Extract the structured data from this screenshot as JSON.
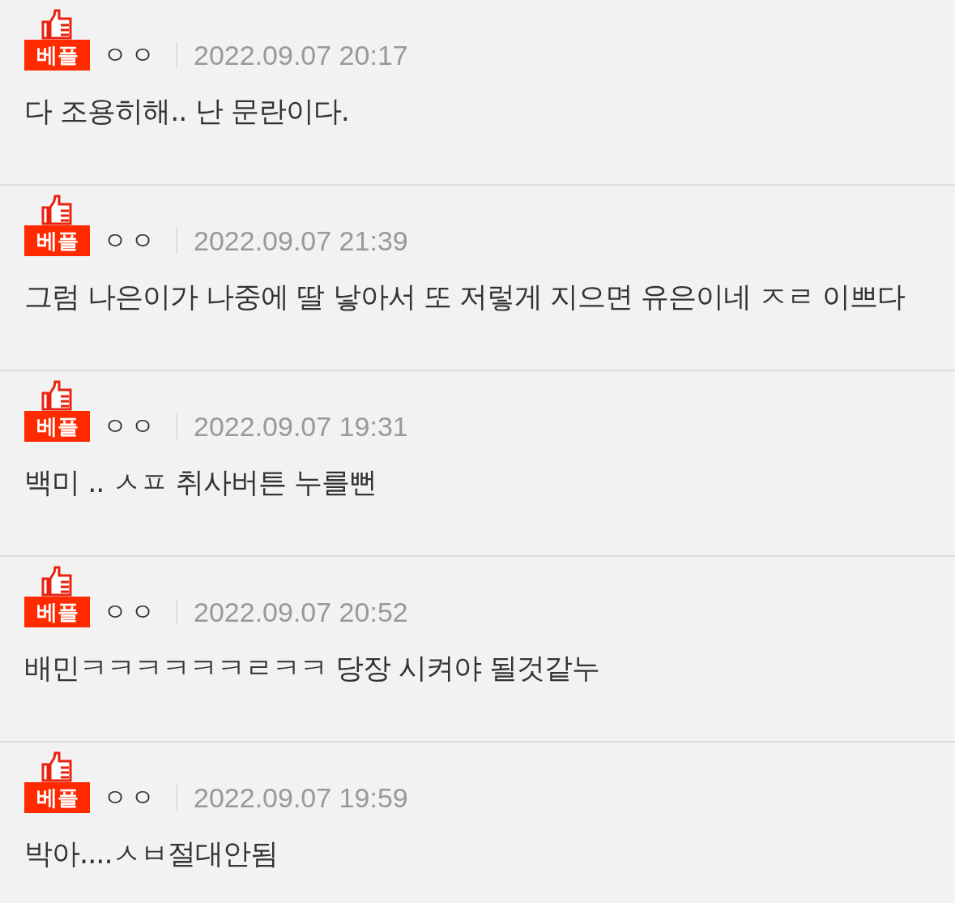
{
  "comments": [
    {
      "badge": "베플",
      "author": "ㅇㅇ",
      "date": "2022.09.07 20:17",
      "text": "다 조용히해.. 난 문란이다."
    },
    {
      "badge": "베플",
      "author": "ㅇㅇ",
      "date": "2022.09.07 21:39",
      "text": "그럼 나은이가 나중에 딸 낳아서 또 저렇게 지으면 유은이네 ㅈㄹ 이쁘다"
    },
    {
      "badge": "베플",
      "author": "ㅇㅇ",
      "date": "2022.09.07 19:31",
      "text": "백미 .. ㅅㅍ 취사버튼 누를뻔"
    },
    {
      "badge": "베플",
      "author": "ㅇㅇ",
      "date": "2022.09.07 20:52",
      "text": "배민ㅋㅋㅋㅋㅋㅋㄹㅋㅋ 당장 시켜야 될것같누"
    },
    {
      "badge": "베플",
      "author": "ㅇㅇ",
      "date": "2022.09.07 19:59",
      "text": "박아....ㅅㅂ절대안됨"
    }
  ]
}
